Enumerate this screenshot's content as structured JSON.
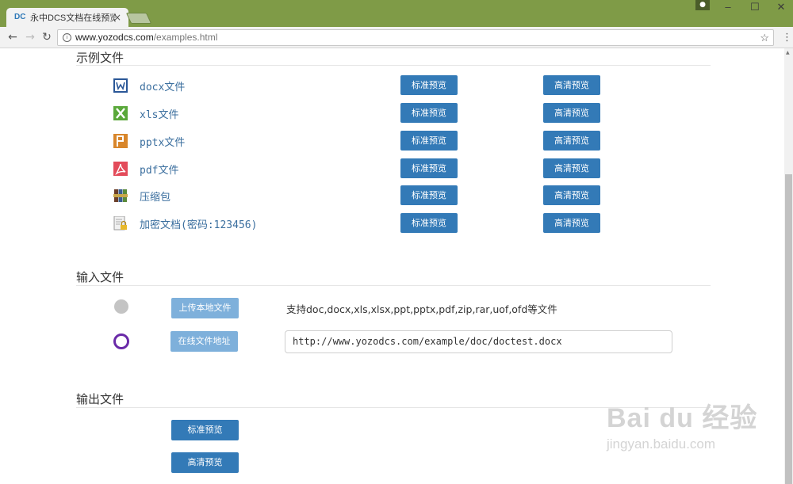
{
  "browser": {
    "tab_title": "永中DCS文档在线预览 -",
    "tab_close": "×",
    "favicon": "DC",
    "url_host": "www.yozodcs.com",
    "url_path": "/examples.html",
    "window_minimize": "–",
    "window_maximize": "☐",
    "window_close": "✕"
  },
  "examples": {
    "title": "示例文件",
    "standard_label": "标准预览",
    "hd_label": "高清预览",
    "items": [
      {
        "label": "docx文件",
        "icon": "word-icon",
        "color": "#2b5797"
      },
      {
        "label": "xls文件",
        "icon": "excel-icon",
        "color": "#5aa83a"
      },
      {
        "label": "pptx文件",
        "icon": "ppt-icon",
        "color": "#d8862b"
      },
      {
        "label": "pdf文件",
        "icon": "pdf-icon",
        "color": "#e34b5a"
      },
      {
        "label": "压缩包",
        "icon": "archive-icon",
        "color": "#6b3f2a"
      },
      {
        "label": "加密文档(密码:123456)",
        "icon": "encrypted-doc-icon",
        "color": "#e8b92c"
      }
    ]
  },
  "input": {
    "title": "输入文件",
    "upload_label": "上传本地文件",
    "support_text": "支持doc,docx,xls,xlsx,ppt,pptx,pdf,zip,rar,uof,ofd等文件",
    "online_label": "在线文件地址",
    "url_value": "http://www.yozodcs.com/example/doc/doctest.docx"
  },
  "output": {
    "title": "输出文件",
    "standard_label": "标准预览",
    "hd_label": "高清预览"
  },
  "watermark": {
    "logo": "Bai du 经验",
    "sub": "jingyan.baidu.com"
  },
  "colors": {
    "accent": "#337ab7",
    "accent_disabled": "#7eb0db",
    "titlebar": "#7f9b47",
    "radio_selected": "#6a2aa8"
  }
}
